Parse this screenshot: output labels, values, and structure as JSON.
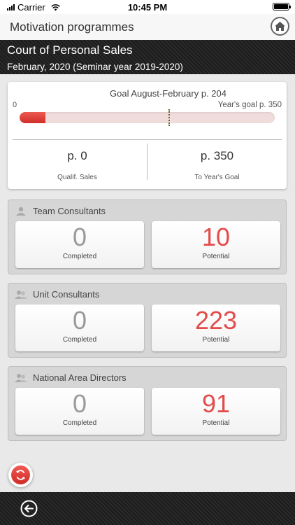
{
  "status_bar": {
    "carrier": "Carrier",
    "time": "10:45 PM"
  },
  "nav": {
    "title": "Motivation programmes",
    "home_icon": "home-icon"
  },
  "header": {
    "title": "Court of Personal Sales",
    "subtitle": "February, 2020 (Seminar year 2019-2020)"
  },
  "goal": {
    "label": "Goal August-February  p. 204",
    "zero": "0",
    "year_goal": "Year's goal  p. 350",
    "progress_fraction": 0.1,
    "goal_fraction": 0.583,
    "qualif_value": "p. 0",
    "qualif_label": "Qualif. Sales",
    "to_goal_value": "p. 350",
    "to_goal_label": "To Year's Goal"
  },
  "panels": [
    {
      "title": "Team Consultants",
      "completed": "0",
      "completed_label": "Completed",
      "potential": "10",
      "potential_label": "Potential"
    },
    {
      "title": "Unit Consultants",
      "completed": "0",
      "completed_label": "Completed",
      "potential": "223",
      "potential_label": "Potential"
    },
    {
      "title": "National Area Directors",
      "completed": "0",
      "completed_label": "Completed",
      "potential": "91",
      "potential_label": "Potential"
    }
  ],
  "colors": {
    "accent_red": "#e34b4b",
    "bar_red": "#d9362e",
    "goal_marker": "#556b22",
    "dark_band": "#222222"
  }
}
